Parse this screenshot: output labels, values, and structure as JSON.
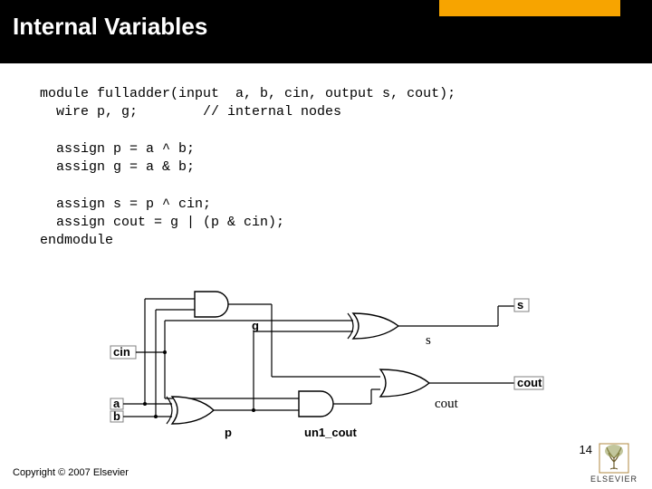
{
  "header": {
    "title": "Internal Variables"
  },
  "code": {
    "line1": "module fulladder(input  a, b, cin, output s, cout);",
    "line2": "  wire p, g;        // internal nodes",
    "line3": "  assign p = a ^ b;",
    "line4": "  assign g = a & b;",
    "line5": "  assign s = p ^ cin;",
    "line6": "  assign cout = g | (p & cin);",
    "line7": "endmodule"
  },
  "diagram_labels": {
    "cin": "cin",
    "a": "a",
    "b": "b",
    "g": "g",
    "p": "p",
    "un1_cout": "un1_cout",
    "s_box": "s",
    "s_text": "s",
    "cout_box": "cout",
    "cout_text": "cout"
  },
  "footer": {
    "copyright": "Copyright © 2007 Elsevier"
  },
  "pagenum": "14",
  "logo": {
    "text": "ELSEVIER"
  }
}
